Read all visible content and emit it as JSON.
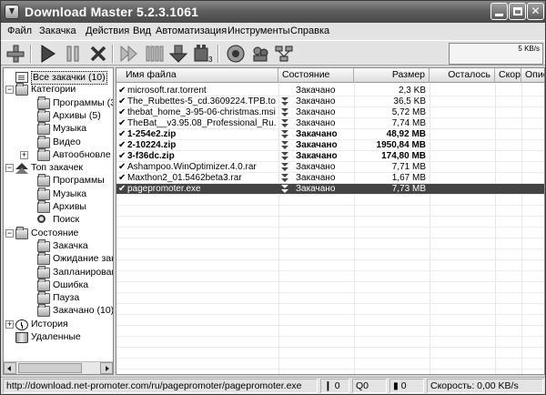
{
  "window": {
    "title": "Download Master 5.2.3.1061"
  },
  "menu": [
    "Файл",
    "Закачка",
    "Действия",
    "Вид",
    "Автоматизация",
    "Инструменты",
    "Справка"
  ],
  "toolbar": {
    "buttons": [
      {
        "name": "add-download-button",
        "icon": "plus-icon"
      },
      {
        "name": "start-button",
        "icon": "play-icon"
      },
      {
        "name": "pause-button",
        "icon": "pause-icon"
      },
      {
        "name": "delete-button",
        "icon": "x-icon"
      },
      {
        "name": "start-all-button",
        "icon": "double-play-icon"
      },
      {
        "name": "pause-all-button",
        "icon": "double-pause-icon"
      },
      {
        "name": "download-queue-button",
        "icon": "down-arrow-icon"
      },
      {
        "name": "scheduler-button",
        "icon": "film-icon"
      },
      {
        "name": "plugin-button",
        "icon": "disc-icon"
      },
      {
        "name": "site-manager-button",
        "icon": "people-icon"
      },
      {
        "name": "network-button",
        "icon": "network-icon"
      }
    ],
    "speed_label": "5 KB/s"
  },
  "tree": [
    {
      "label": "Все закачки (10)",
      "level": 0,
      "icon": "doc-icon",
      "selected": true
    },
    {
      "label": "Категории",
      "level": 0,
      "icon": "folder-icon",
      "expander": "−"
    },
    {
      "label": "Программы (3",
      "level": 1,
      "icon": "folder-icon"
    },
    {
      "label": "Архивы (5)",
      "level": 1,
      "icon": "folder-icon"
    },
    {
      "label": "Музыка",
      "level": 1,
      "icon": "folder-icon"
    },
    {
      "label": "Видео",
      "level": 1,
      "icon": "folder-icon"
    },
    {
      "label": "Автообновле",
      "level": 1,
      "icon": "folder-icon",
      "expander": "+"
    },
    {
      "label": "Топ закачек",
      "level": 0,
      "icon": "up-icon",
      "expander": "−"
    },
    {
      "label": "Программы",
      "level": 1,
      "icon": "folder-icon"
    },
    {
      "label": "Музыка",
      "level": 1,
      "icon": "folder-icon"
    },
    {
      "label": "Архивы",
      "level": 1,
      "icon": "folder-icon"
    },
    {
      "label": "Поиск",
      "level": 1,
      "icon": "search-icon"
    },
    {
      "label": "Состояние",
      "level": 0,
      "icon": "folder-icon",
      "expander": "−"
    },
    {
      "label": "Закачка",
      "level": 1,
      "icon": "folder-icon"
    },
    {
      "label": "Ожидание зак",
      "level": 1,
      "icon": "folder-icon"
    },
    {
      "label": "Запланирован",
      "level": 1,
      "icon": "folder-icon"
    },
    {
      "label": "Ошибка",
      "level": 1,
      "icon": "folder-icon"
    },
    {
      "label": "Пауза",
      "level": 1,
      "icon": "folder-icon"
    },
    {
      "label": "Закачано (10)",
      "level": 1,
      "icon": "folder-icon"
    },
    {
      "label": "История",
      "level": 0,
      "icon": "clock-icon",
      "expander": "+"
    },
    {
      "label": "Удаленные",
      "level": 0,
      "icon": "trash-icon"
    }
  ],
  "columns": [
    "Имя файла",
    "Состояние",
    "Размер",
    "Осталось",
    "Скорость",
    "Опис"
  ],
  "rows": [
    {
      "name": "microsoft.rar.torrent",
      "status": "Закачано",
      "size": "2,3 KB",
      "bold": false,
      "icon": false,
      "selected": false
    },
    {
      "name": "The_Rubettes-5_cd.3609224.TPB.to...",
      "status": "Закачано",
      "size": "36,5 KB",
      "bold": false,
      "icon": true,
      "selected": false
    },
    {
      "name": "thebat_home_3-95-06-christmas.msi",
      "status": "Закачано",
      "size": "5,72 MB",
      "bold": false,
      "icon": true,
      "selected": false
    },
    {
      "name": "TheBat__v3.95.08_Professional_Ru...",
      "status": "Закачано",
      "size": "7,74 MB",
      "bold": false,
      "icon": true,
      "selected": false
    },
    {
      "name": "1-254e2.zip",
      "status": "Закачано",
      "size": "48,92 MB",
      "bold": true,
      "icon": true,
      "selected": false
    },
    {
      "name": "2-10224.zip",
      "status": "Закачано",
      "size": "1950,84 MB",
      "bold": true,
      "icon": true,
      "selected": false
    },
    {
      "name": "3-f36dc.zip",
      "status": "Закачано",
      "size": "174,80 MB",
      "bold": true,
      "icon": true,
      "selected": false
    },
    {
      "name": "Ashampoo.WinOptimizer.4.0.rar",
      "status": "Закачано",
      "size": "7,71 MB",
      "bold": false,
      "icon": true,
      "selected": false
    },
    {
      "name": "Maxthon2_01.5462beta3.rar",
      "status": "Закачано",
      "size": "1,67 MB",
      "bold": false,
      "icon": true,
      "selected": false
    },
    {
      "name": "pagepromoter.exe",
      "status": "Закачано",
      "size": "7,73 MB",
      "bold": false,
      "icon": true,
      "selected": true
    }
  ],
  "statusbar": {
    "url": "http://download.net-promoter.com/ru/pagepromoter/pagepromoter.exe",
    "count1": "0",
    "count2": "0",
    "count3": "0",
    "speed": "Скорость: 0,00 KB/s"
  }
}
